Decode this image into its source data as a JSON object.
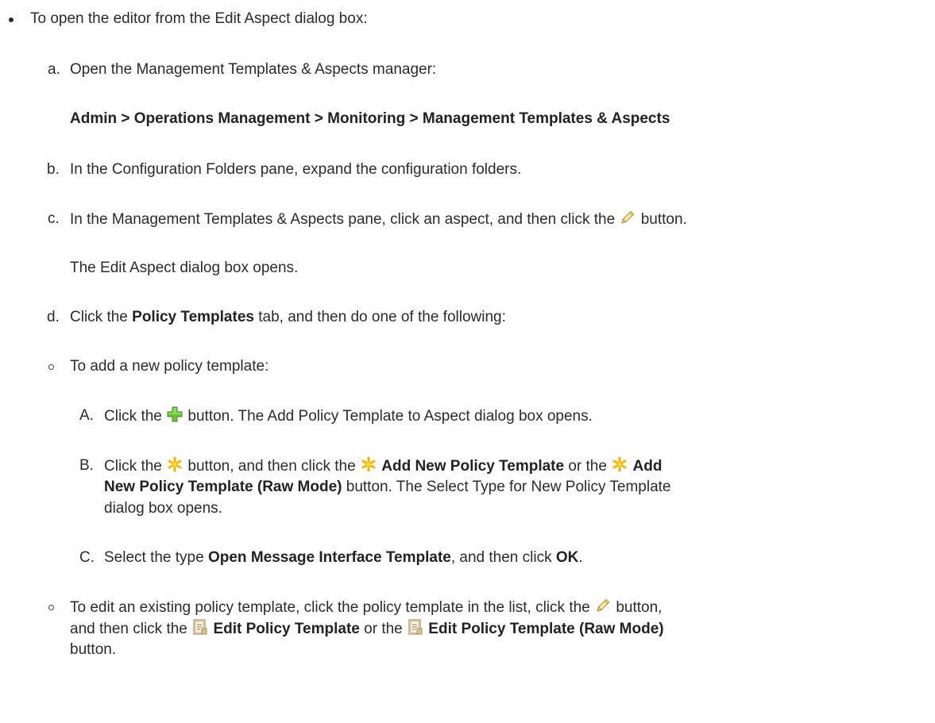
{
  "intro": "To open the editor from the Edit Aspect dialog box:",
  "steps": {
    "a": {
      "marker": "a.",
      "text": "Open the Management Templates & Aspects manager:",
      "path": "Admin > Operations Management > Monitoring > Management Templates & Aspects"
    },
    "b": {
      "marker": "b.",
      "text": "In the Configuration Folders pane, expand the configuration folders."
    },
    "c": {
      "marker": "c.",
      "text_before": "In the Management Templates & Aspects pane, click an aspect, and then click the",
      "text_after": "button.",
      "result": "The Edit Aspect dialog box opens."
    },
    "d": {
      "marker": "d.",
      "text_1": "Click the",
      "bold_1": "Policy Templates",
      "text_2": "tab, and then do one of the following:",
      "options": {
        "add": {
          "text": "To add a new policy template:",
          "A": {
            "marker": "A.",
            "text_1": "Click the",
            "text_2": "button. The Add Policy Template to Aspect dialog box opens."
          },
          "B": {
            "marker": "B.",
            "text_1": "Click the",
            "text_2": "button, and then click the",
            "bold_1": "Add New Policy Template",
            "text_3": "or the",
            "bold_2": "Add",
            "bold_3": "New Policy Template (Raw Mode)",
            "text_4": "button. The Select Type for New Policy Template",
            "text_5": "dialog box opens."
          },
          "C": {
            "marker": "C.",
            "text_1": "Select the type",
            "bold_1": "Open Message Interface Template",
            "text_2": ", and then click",
            "bold_2": "OK",
            "text_3": "."
          }
        },
        "edit": {
          "text_1": "To edit an existing policy template, click the policy template in the list, click the",
          "text_2": "button,",
          "text_3": "and then click the",
          "bold_1": "Edit Policy Template",
          "text_4": "or the",
          "bold_2": "Edit Policy Template (Raw Mode)",
          "text_5": "button."
        }
      }
    }
  },
  "icons": {
    "edit": "pencil-icon",
    "add": "green-plus-icon",
    "new": "yellow-asterisk-icon",
    "policy": "policy-template-icon"
  },
  "colors": {
    "text": "#2b2b2b",
    "plus": "#5cb82e",
    "asterisk": "#f4b400"
  }
}
